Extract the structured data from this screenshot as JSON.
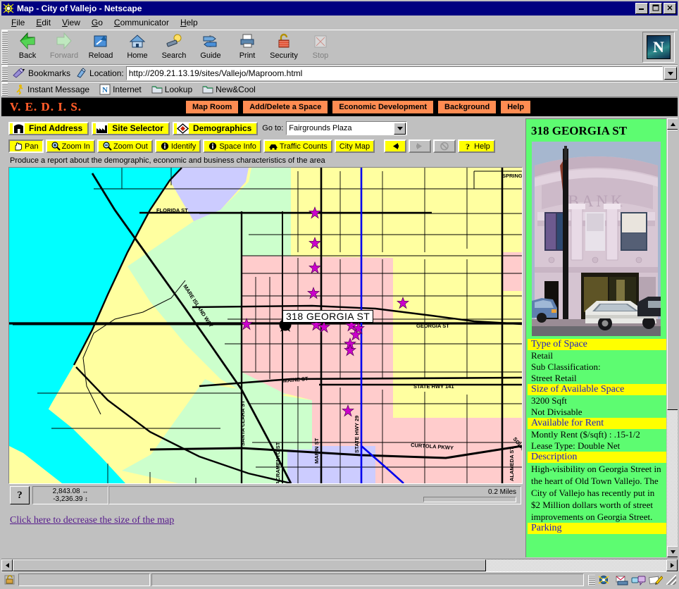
{
  "window": {
    "title": "Map - City of Vallejo - Netscape",
    "minimize": "_",
    "maximize": "□",
    "close": "✕"
  },
  "menubar": [
    "File",
    "Edit",
    "View",
    "Go",
    "Communicator",
    "Help"
  ],
  "toolbar": {
    "buttons": [
      {
        "label": "Back",
        "icon": "back-arrow-icon",
        "disabled": false
      },
      {
        "label": "Forward",
        "icon": "forward-arrow-icon",
        "disabled": true
      },
      {
        "label": "Reload",
        "icon": "reload-icon",
        "disabled": false
      },
      {
        "label": "Home",
        "icon": "home-icon",
        "disabled": false
      },
      {
        "label": "Search",
        "icon": "search-flashlight-icon",
        "disabled": false
      },
      {
        "label": "Guide",
        "icon": "signpost-icon",
        "disabled": false
      },
      {
        "label": "Print",
        "icon": "printer-icon",
        "disabled": false
      },
      {
        "label": "Security",
        "icon": "padlock-icon",
        "disabled": false
      },
      {
        "label": "Stop",
        "icon": "stop-icon",
        "disabled": true
      }
    ],
    "logo_letter": "N"
  },
  "location": {
    "bookmarks_label": "Bookmarks",
    "label": "Location:",
    "url": "http://209.21.13.19/sites/Vallejo/Maproom.html"
  },
  "personal_toolbar": [
    {
      "label": "Instant Message",
      "icon": "running-person-icon"
    },
    {
      "label": "Internet",
      "icon": "netscape-n-icon"
    },
    {
      "label": "Lookup",
      "icon": "folder-icon"
    },
    {
      "label": "New&Cool",
      "icon": "folder-icon"
    }
  ],
  "vedis": {
    "logo": "V. E. D. I. S.",
    "nav": [
      "Map Room",
      "Add/Delete a Space",
      "Economic Development",
      "Background",
      "Help"
    ],
    "nav_bg": "#ff8c52",
    "logo_color": "#ff5a2b"
  },
  "apptabs": [
    {
      "label": "Find Address",
      "icon": "building-icon"
    },
    {
      "label": "Site Selector",
      "icon": "factory-icon"
    },
    {
      "label": "Demographics",
      "icon": "diamond-book-icon"
    }
  ],
  "goto": {
    "label": "Go to:",
    "value": "Fairgrounds Plaza",
    "arrow": "▼"
  },
  "maptools": [
    {
      "label": "Pan",
      "icon": "hand-icon",
      "state": "selected"
    },
    {
      "label": "Zoom In",
      "icon": "magnifier-plus-icon",
      "state": "normal"
    },
    {
      "label": "Zoom Out",
      "icon": "magnifier-minus-icon",
      "state": "normal"
    },
    {
      "label": "Identify",
      "icon": "info-circle-icon",
      "state": "normal"
    },
    {
      "label": "Space Info",
      "icon": "info-circle-icon",
      "state": "normal"
    },
    {
      "label": "Traffic Counts",
      "icon": "traffic-car-icon",
      "state": "normal"
    },
    {
      "label": "City Map",
      "icon": "",
      "state": "normal"
    }
  ],
  "navarrows": [
    {
      "label": "⬅",
      "icon": "left-arrow-icon",
      "state": "normal"
    },
    {
      "label": "➡",
      "icon": "right-arrow-icon",
      "state": "disabled"
    },
    {
      "label": "⊗",
      "icon": "globe-reset-icon",
      "state": "disabled"
    }
  ],
  "helpbtn": {
    "label": "Help",
    "icon": "question-mark-icon"
  },
  "hint": "Produce a report about the demographic, economic and business characteristics of the area",
  "map": {
    "callout": "318 GEORGIA ST",
    "street_labels": [
      "FLORIDA ST",
      "SANTA CLARA ST",
      "SACRAMENTO ST",
      "MARIN ST",
      "STATE HWY 29",
      "GEORGIA ST",
      "ALAMEDA ST",
      "MAINE ST",
      "STATE HWY 141",
      "CURTOLA PKWY",
      "MARE ISLAND WAY",
      "SPRINGS",
      "SOLANO"
    ],
    "colors": {
      "water": "#00ffff",
      "residential_yellow": "#ffffa0",
      "commercial_pink": "#ffcccc",
      "park_green": "#ccffcc",
      "institutional_purple": "#ccccff",
      "marker": "#cc00cc"
    },
    "coord_x": "2,843.08",
    "coord_y": "-3,236.39",
    "coord_x_glyph": "↔",
    "coord_y_glyph": "↕",
    "scale_label": "0.2 Miles",
    "help_glyph": "?"
  },
  "map_link": "Click here to decrease the size of the map",
  "property": {
    "title": "318 GEORGIA ST",
    "photo_alt": "Historic bank building facade on Georgia Street",
    "sections": [
      {
        "header": "Type of Space",
        "lines": [
          "Retail",
          "Sub Classification:",
          "Street Retail"
        ]
      },
      {
        "header": "Size of Available Space",
        "lines": [
          "3200 Sqft",
          "Not Divisable"
        ]
      },
      {
        "header": "Available for Rent",
        "lines": [
          "Montly Rent ($/sqft) : .15-1/2",
          "Lease Type: Double Net"
        ]
      },
      {
        "header": "Description",
        "lines": [
          "High-visibility on Georgia Street in the heart of Old Town Vallejo. The City of Vallejo has recently put in $2 Million dollars worth of street improvements on Georgia Street."
        ]
      },
      {
        "header": "Parking",
        "lines": []
      }
    ],
    "header_bg": "#ffff00",
    "header_color": "#1a1acc",
    "panel_bg": "#5dfc71"
  },
  "scroll": {
    "up": "▲",
    "down": "▼",
    "left": "◄",
    "right": "►"
  },
  "statusbar": {
    "lock_icon": "padlock-icon",
    "components": [
      "navigator-icon",
      "mailbox-icon",
      "newsgroup-icon",
      "composer-icon"
    ]
  }
}
